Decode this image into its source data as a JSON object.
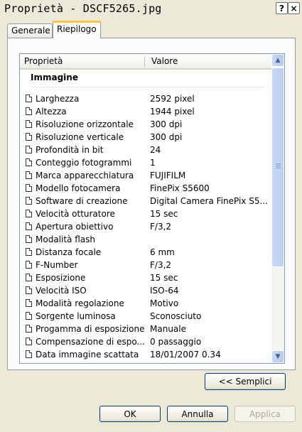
{
  "window": {
    "title": "Proprietà - DSCF5265.jpg",
    "help_label": "?",
    "close_label": "×"
  },
  "tabs": [
    {
      "label": "Generale",
      "selected": false
    },
    {
      "label": "Riepilogo",
      "selected": true
    }
  ],
  "list": {
    "columns": [
      "Proprietà",
      "Valore"
    ],
    "group": "Immagine",
    "rows": [
      {
        "property": "Larghezza",
        "value": "2592 pixel"
      },
      {
        "property": "Altezza",
        "value": "1944 pixel"
      },
      {
        "property": "Risoluzione orizzontale",
        "value": "300 dpi"
      },
      {
        "property": "Risoluzione verticale",
        "value": "300 dpi"
      },
      {
        "property": "Profondità in bit",
        "value": "24"
      },
      {
        "property": "Conteggio fotogrammi",
        "value": "1"
      },
      {
        "property": "Marca apparecchiatura",
        "value": "FUJIFILM"
      },
      {
        "property": "Modello fotocamera",
        "value": "FinePix S5600"
      },
      {
        "property": "Software di creazione",
        "value": "Digital Camera FinePix S5..."
      },
      {
        "property": "Velocità otturatore",
        "value": "15 sec"
      },
      {
        "property": "Apertura obiettivo",
        "value": "F/3,2"
      },
      {
        "property": "Modalità flash",
        "value": ""
      },
      {
        "property": "Distanza focale",
        "value": "6 mm"
      },
      {
        "property": "F-Number",
        "value": "F/3,2"
      },
      {
        "property": "Esposizione",
        "value": "15 sec"
      },
      {
        "property": "Velocità ISO",
        "value": "ISO-64"
      },
      {
        "property": "Modalità regolazione",
        "value": "Motivo"
      },
      {
        "property": "Sorgente luminosa",
        "value": "Sconosciuto"
      },
      {
        "property": "Progamma di esposizione",
        "value": "Manuale"
      },
      {
        "property": "Compensazione di espo...",
        "value": "0 passaggio"
      },
      {
        "property": "Data immagine scattata",
        "value": "18/01/2007 0.34"
      }
    ]
  },
  "buttons": {
    "simple": "<< Semplici",
    "ok": "OK",
    "cancel": "Annulla",
    "apply": "Applica"
  },
  "scrollbar": {
    "up_glyph": "▲",
    "down_glyph": "▼"
  }
}
